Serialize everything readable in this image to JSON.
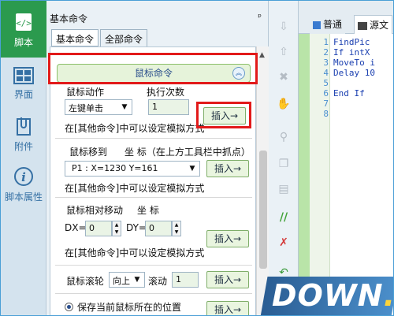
{
  "nav": {
    "items": [
      {
        "label": "脚本",
        "icon": "code-icon"
      },
      {
        "label": "界面",
        "icon": "grid-icon"
      },
      {
        "label": "附件",
        "icon": "clip-icon"
      },
      {
        "label": "脚本属性",
        "icon": "info-icon"
      }
    ]
  },
  "panel": {
    "title": "基本命令",
    "pin": "ᵖ",
    "tabs": [
      "基本命令",
      "全部命令"
    ]
  },
  "mouse": {
    "header": "鼠标命令",
    "action_label": "鼠标动作",
    "count_label": "执行次数",
    "action_value": "左键单击",
    "count_value": "1",
    "insert": "插入→",
    "hint": "在[其他命令]中可以设定模拟方式",
    "move_label": "鼠标移到",
    "coord_label": "坐 标（在上方工具栏中抓点）",
    "point_value": "P1 : X=1230 Y=161",
    "rel_label": "鼠标相对移动",
    "rel_coord": "坐 标",
    "dx_label": "DX=",
    "dx": "0",
    "dy_label": "DY=",
    "dy": "0",
    "wheel_label": "鼠标滚轮",
    "wheel_dir": "向上",
    "scroll_label": "滚动",
    "scroll_value": "1",
    "save_pos": "保存当前鼠标所在的位置"
  },
  "editor": {
    "tabs": [
      "普通",
      "源文"
    ],
    "lines": [
      "1",
      "2",
      "3",
      "4",
      "5",
      "6",
      "7",
      "8"
    ],
    "code": [
      "FindPic",
      "If intX",
      "MoveTo i",
      "Delay 10",
      "",
      "End If"
    ]
  },
  "watermark": {
    "main": "DOWN",
    "suffix": ".cc"
  }
}
